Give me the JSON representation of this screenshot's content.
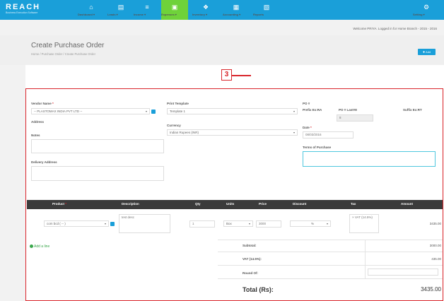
{
  "brand": {
    "name": "REACH",
    "tagline": "Business Execution Software"
  },
  "nav": [
    {
      "icon": "⌂",
      "label": "Dashboard ▾",
      "active": false
    },
    {
      "icon": "▤",
      "label": "Leads ▾",
      "active": false
    },
    {
      "icon": "≡",
      "label": "Income ▾",
      "active": false
    },
    {
      "icon": "▣",
      "label": "Expenses ▾",
      "active": true
    },
    {
      "icon": "❖",
      "label": "Inventory ▾",
      "active": false
    },
    {
      "icon": "▦",
      "label": "Accounting ▾",
      "active": false
    },
    {
      "icon": "▧",
      "label": "Reports",
      "active": false
    }
  ],
  "settings": {
    "icon": "⚙",
    "label": "Setting ▾"
  },
  "welcome": "Welcome PRIYA. Logged in for Home Branch - 2015 - 2016",
  "page_title": "Create Purchase Order",
  "breadcrumb": "Home / Purchase Order / Create Purchase Order",
  "add_button": "✚ Add",
  "callout": "3",
  "form": {
    "vendor_label": "Vendor Name",
    "required_mark": "*",
    "vendor_value": "-- PLASTOMAX INDIA PVT LTD --",
    "address_label": "Address",
    "notes_label": "Notes",
    "delivery_label": "Delivery Address",
    "print_template_label": "Print Template",
    "print_template_value": "Template 1",
    "currency_label": "Currency",
    "currency_value": "Indian Rupees (INR)",
    "po_label": "PO #",
    "prefix_label": "Prefix Ex:RA",
    "last_label": "PO # Last#8",
    "suffix_label": "Suffix Ex:RT",
    "po_number": "8",
    "date_label": "Date",
    "date_value": "08/03/2016",
    "terms_label": "Terms of Purchase"
  },
  "table": {
    "headers": [
      "Product",
      "Description",
      "Qty",
      "Units",
      "Price",
      "Discount",
      "Tax",
      "Amount"
    ],
    "row": {
      "product": "com bcd ( -- )",
      "description": "test desc",
      "qty": "1",
      "unit": "Box",
      "price": "3000",
      "discount_unit": "%",
      "tax": "× VAT (14.5%)",
      "amount": "3435.00"
    }
  },
  "add_line": "Add a line",
  "totals": {
    "subtotal_label": "Subtotal:",
    "subtotal_value": "3000.00",
    "vat_label": "VAT (14.5%):",
    "vat_value": "435.00",
    "roundoff_label": "Round Of:",
    "total_label": "Total (Rs):",
    "total_value": "3435.00"
  }
}
